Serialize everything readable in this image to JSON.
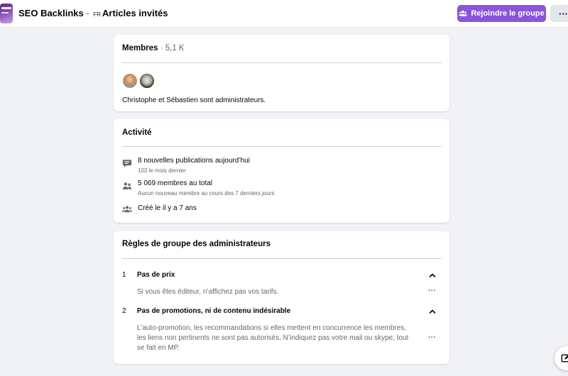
{
  "header": {
    "group_name": "SEO Backlinks",
    "separator": " - ",
    "language_code": "FR",
    "subtitle": "Articles invités",
    "join_button_label": "Rejoindre le groupe",
    "more_button_label": "···",
    "accent_color": "#8b55d9"
  },
  "members": {
    "title": "Membres",
    "dot": " · ",
    "count": "5,1 K",
    "admins_text": "Christophe et Sébastien sont administrateurs."
  },
  "activity": {
    "title": "Activité",
    "rows": [
      {
        "icon": "chat-bubble-icon",
        "main": "8 nouvelles publications aujourd’hui",
        "sub": "103 le mois dernier"
      },
      {
        "icon": "people-icon",
        "main": "5 069 membres au total",
        "sub": "Aucun nouveau membre au cours des 7 derniers jours"
      },
      {
        "icon": "group-icon",
        "main": "Créé le il y a 7 ans",
        "sub": ""
      }
    ]
  },
  "rules": {
    "title": "Règles de groupe des administrateurs",
    "items": [
      {
        "number": "1",
        "title": "Pas de prix",
        "description": "Si vous êtes éditeur, n’affichez pas vos tarifs.",
        "more": "···"
      },
      {
        "number": "2",
        "title": "Pas de promotions, ni de contenu indésirable",
        "description": "L’auto-promotion, les recommandations si elles mettent en concurrence les membres, les liens non pertinents ne sont pas autorisés. N’indiquez pas votre mail ou skype, tout se fait en MP.",
        "more": "···"
      }
    ]
  }
}
